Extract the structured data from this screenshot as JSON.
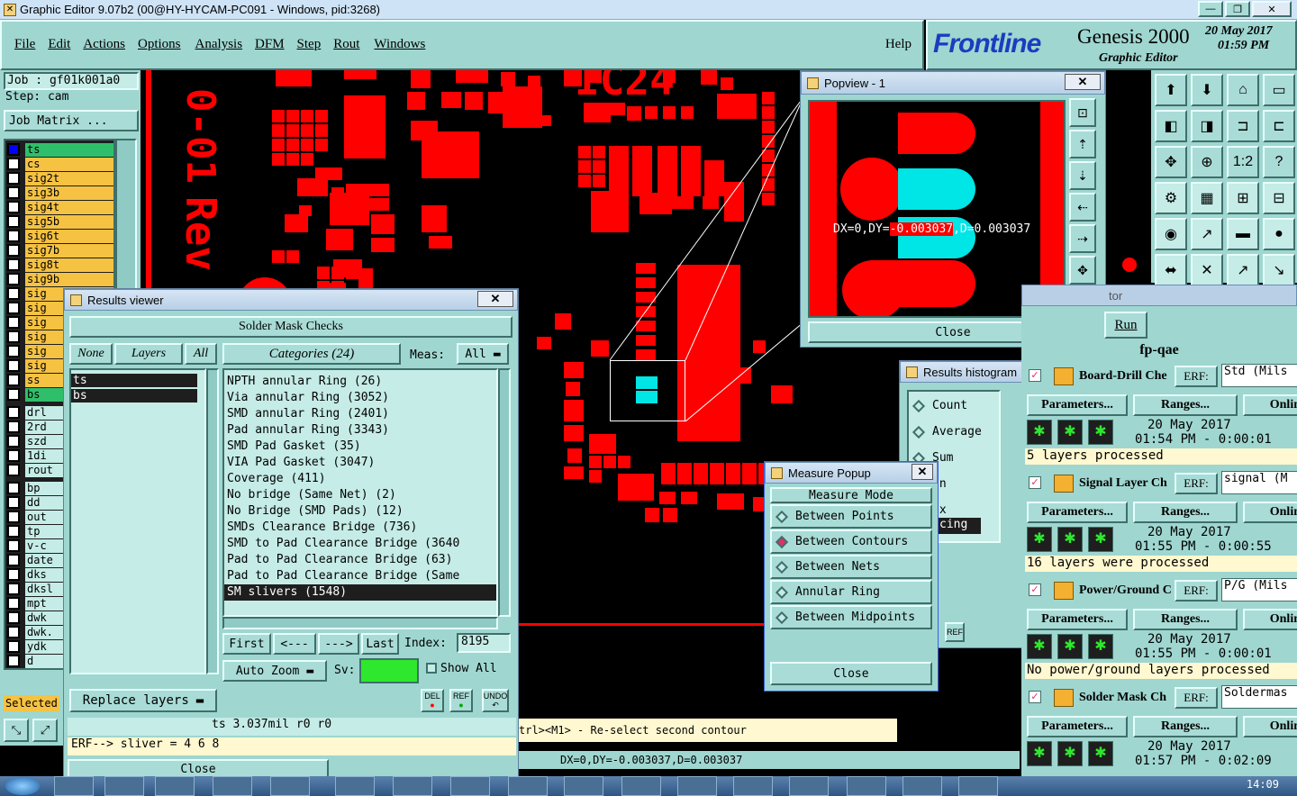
{
  "title_bar": {
    "title": "Graphic Editor 9.07b2 (00@HY-HYCAM-PC091 - Windows, pid:3268)",
    "controls": [
      "—",
      "❐",
      "✕"
    ]
  },
  "menu": {
    "items": [
      "File",
      "Edit",
      "Actions",
      "Options",
      "Analysis",
      "DFM",
      "Step",
      "Rout",
      "Windows"
    ],
    "help": "Help"
  },
  "brand": {
    "logo": "Frontline",
    "product": "Genesis 2000",
    "subtitle": "Graphic Editor",
    "date": "20 May 2017",
    "time": "01:59 PM"
  },
  "left": {
    "job": "Job : gf01k001a0",
    "step": "Step: cam",
    "job_matrix": "Job Matrix ...",
    "selected": "Selected",
    "layers": [
      "ts",
      "cs",
      "sig2t",
      "sig3b",
      "sig4t",
      "sig5b",
      "sig6t",
      "sig7b",
      "sig8t",
      "sig9b",
      "sig",
      "sig",
      "sig",
      "sig",
      "sig",
      "sig",
      "ss",
      "bs"
    ],
    "layers2": [
      "drl",
      "2rd",
      "szd",
      "1di",
      "rout"
    ],
    "layers3": [
      "bp",
      "dd",
      "out",
      "tp",
      "v-c",
      "date",
      "dks",
      "dksl",
      "mpt",
      "dwk",
      "dwk.",
      "ydk",
      "d"
    ]
  },
  "canvas": {
    "texts": [
      "IC24",
      "0-01",
      "Rev"
    ]
  },
  "results_viewer": {
    "title": "Results viewer",
    "header": "Solder Mask Checks",
    "none": "None",
    "layers": "Layers",
    "all": "All",
    "categories_label": "Categories (24)",
    "meas_label": "Meas:",
    "meas_value": "All",
    "layer_items": [
      "ts",
      "bs"
    ],
    "categories": [
      "NPTH annular Ring (26)",
      "Via annular Ring (3052)",
      "SMD annular Ring (2401)",
      "Pad annular Ring (3343)",
      "SMD Pad Gasket (35)",
      "VIA Pad Gasket (3047)",
      "Coverage (411)",
      "No bridge (Same Net) (2)",
      "No Bridge (SMD Pads) (12)",
      "SMDs Clearance Bridge (736)",
      "SMD to Pad Clearance Bridge (3640",
      "Pad to Pad Clearance Bridge (63)",
      "Pad to Pad Clearance Bridge (Same",
      "SM slivers (1548)"
    ],
    "first": "First",
    "prev": "<---",
    "next": "--->",
    "last": "Last",
    "index_label": "Index:",
    "index_value": "8195",
    "auto_zoom": "Auto Zoom",
    "sv": "Sv:",
    "show_all": "Show All",
    "replace_layers": "Replace layers",
    "del": "DEL",
    "ref": "REF",
    "undo": "UNDO",
    "status1": "ts 3.037mil  r0  r0",
    "status2": "ERF--> sliver = 4 6 8",
    "close": "Close"
  },
  "popview": {
    "title": "Popview - 1",
    "measure_pre": "DX=0,DY=",
    "measure_hl": "-0.003037",
    "measure_post": ",D=0.003037",
    "close": "Close"
  },
  "histogram": {
    "title": "Results histogram",
    "items": [
      "Count",
      "Average",
      "Sum",
      "in",
      "ax"
    ],
    "field": "cing",
    "ref": "REF"
  },
  "measure_popup": {
    "title": "Measure Popup",
    "mode": "Measure Mode",
    "options": [
      "Between Points",
      "Between Contours",
      "Between Nets",
      "Annular Ring",
      "Between Midpoints"
    ],
    "selected": 1,
    "close": "Close"
  },
  "bottom": {
    "prompt": "trl><M1> - Re-select second contour",
    "measure": "DX=0,DY=-0.003037,D=0.003037"
  },
  "qae": {
    "partial_title": "tor",
    "run": "Run",
    "header": "fp-qae",
    "erf": "ERF:",
    "params": "Parameters...",
    "ranges": "Ranges...",
    "online": "Onlin",
    "rows": [
      {
        "name": "Board-Drill Che",
        "field": "Std (Mils",
        "date": "20 May 2017",
        "time": "01:54 PM - 0:00:01",
        "status": "5 layers processed"
      },
      {
        "name": "Signal Layer Ch",
        "field": "signal (M",
        "date": "20 May 2017",
        "time": "01:55 PM - 0:00:55",
        "status": "16 layers were processed"
      },
      {
        "name": "Power/Ground C",
        "field": "P/G (Mils",
        "date": "20 May 2017",
        "time": "01:55 PM - 0:00:01",
        "status": "No power/ground layers processed"
      },
      {
        "name": "Solder Mask Ch",
        "field": "Soldermas",
        "date": "20 May 2017",
        "time": "01:57 PM - 0:02:09",
        "status": ""
      }
    ]
  },
  "taskbar": {
    "clock": "14:09"
  },
  "colors": {
    "copper": "#ff0000",
    "highlight": "#00e5e5",
    "panel": "#9fd6d0",
    "layer": "#f5c242"
  }
}
